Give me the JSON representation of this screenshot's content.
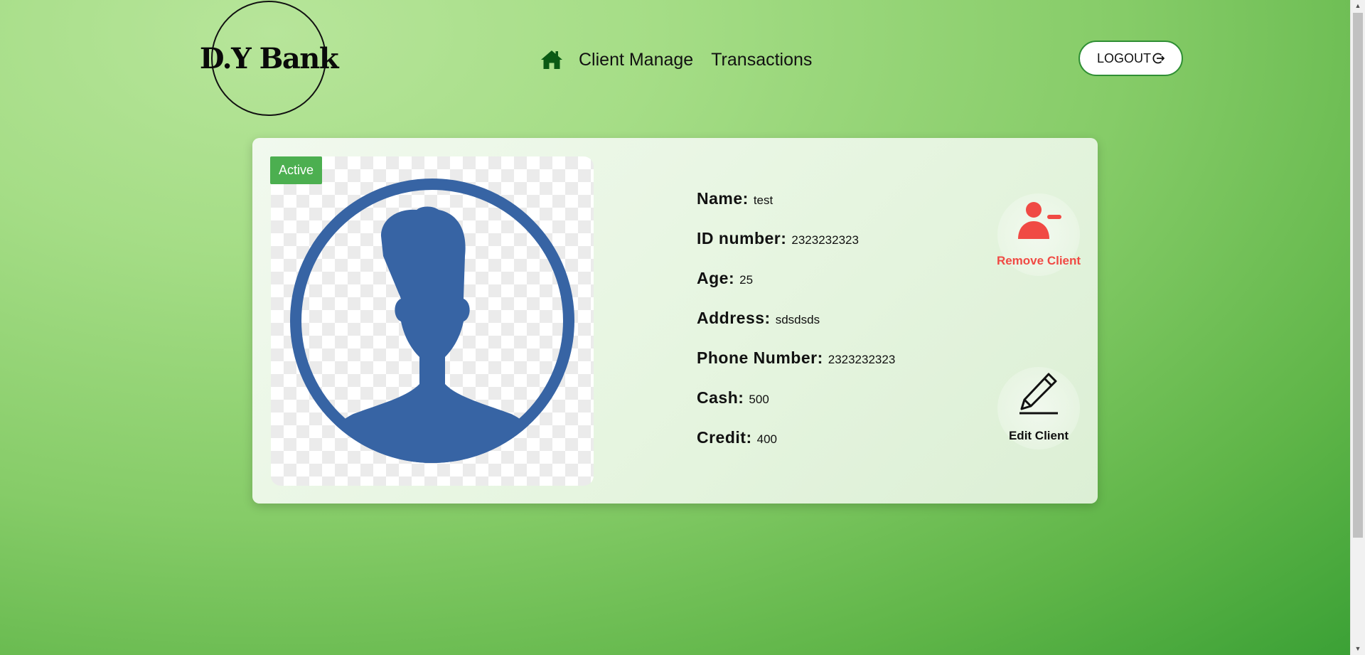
{
  "brand": {
    "logo_text": "D.Y Bank"
  },
  "nav": {
    "home_icon": "home-icon",
    "links": [
      {
        "label": "Client Manage"
      },
      {
        "label": "Transactions"
      }
    ]
  },
  "header": {
    "logout_label": "LOGOUT",
    "logout_icon": "logout-icon"
  },
  "client": {
    "status": "Active",
    "fields": [
      {
        "label": "Name:",
        "value": "test"
      },
      {
        "label": "ID number:",
        "value": "2323232323"
      },
      {
        "label": "Age:",
        "value": "25"
      },
      {
        "label": "Address:",
        "value": "sdsdsds"
      },
      {
        "label": "Phone Number:",
        "value": "2323232323"
      },
      {
        "label": "Cash:",
        "value": "500"
      },
      {
        "label": "Credit:",
        "value": "400"
      }
    ]
  },
  "actions": {
    "remove_label": "Remove Client",
    "remove_icon": "remove-user-icon",
    "edit_label": "Edit Client",
    "edit_icon": "pencil-icon"
  },
  "colors": {
    "accent_green": "#4caf50",
    "nav_icon_green": "#0a5a14",
    "remove_red": "#f04a44",
    "avatar_blue": "#3764a4"
  }
}
